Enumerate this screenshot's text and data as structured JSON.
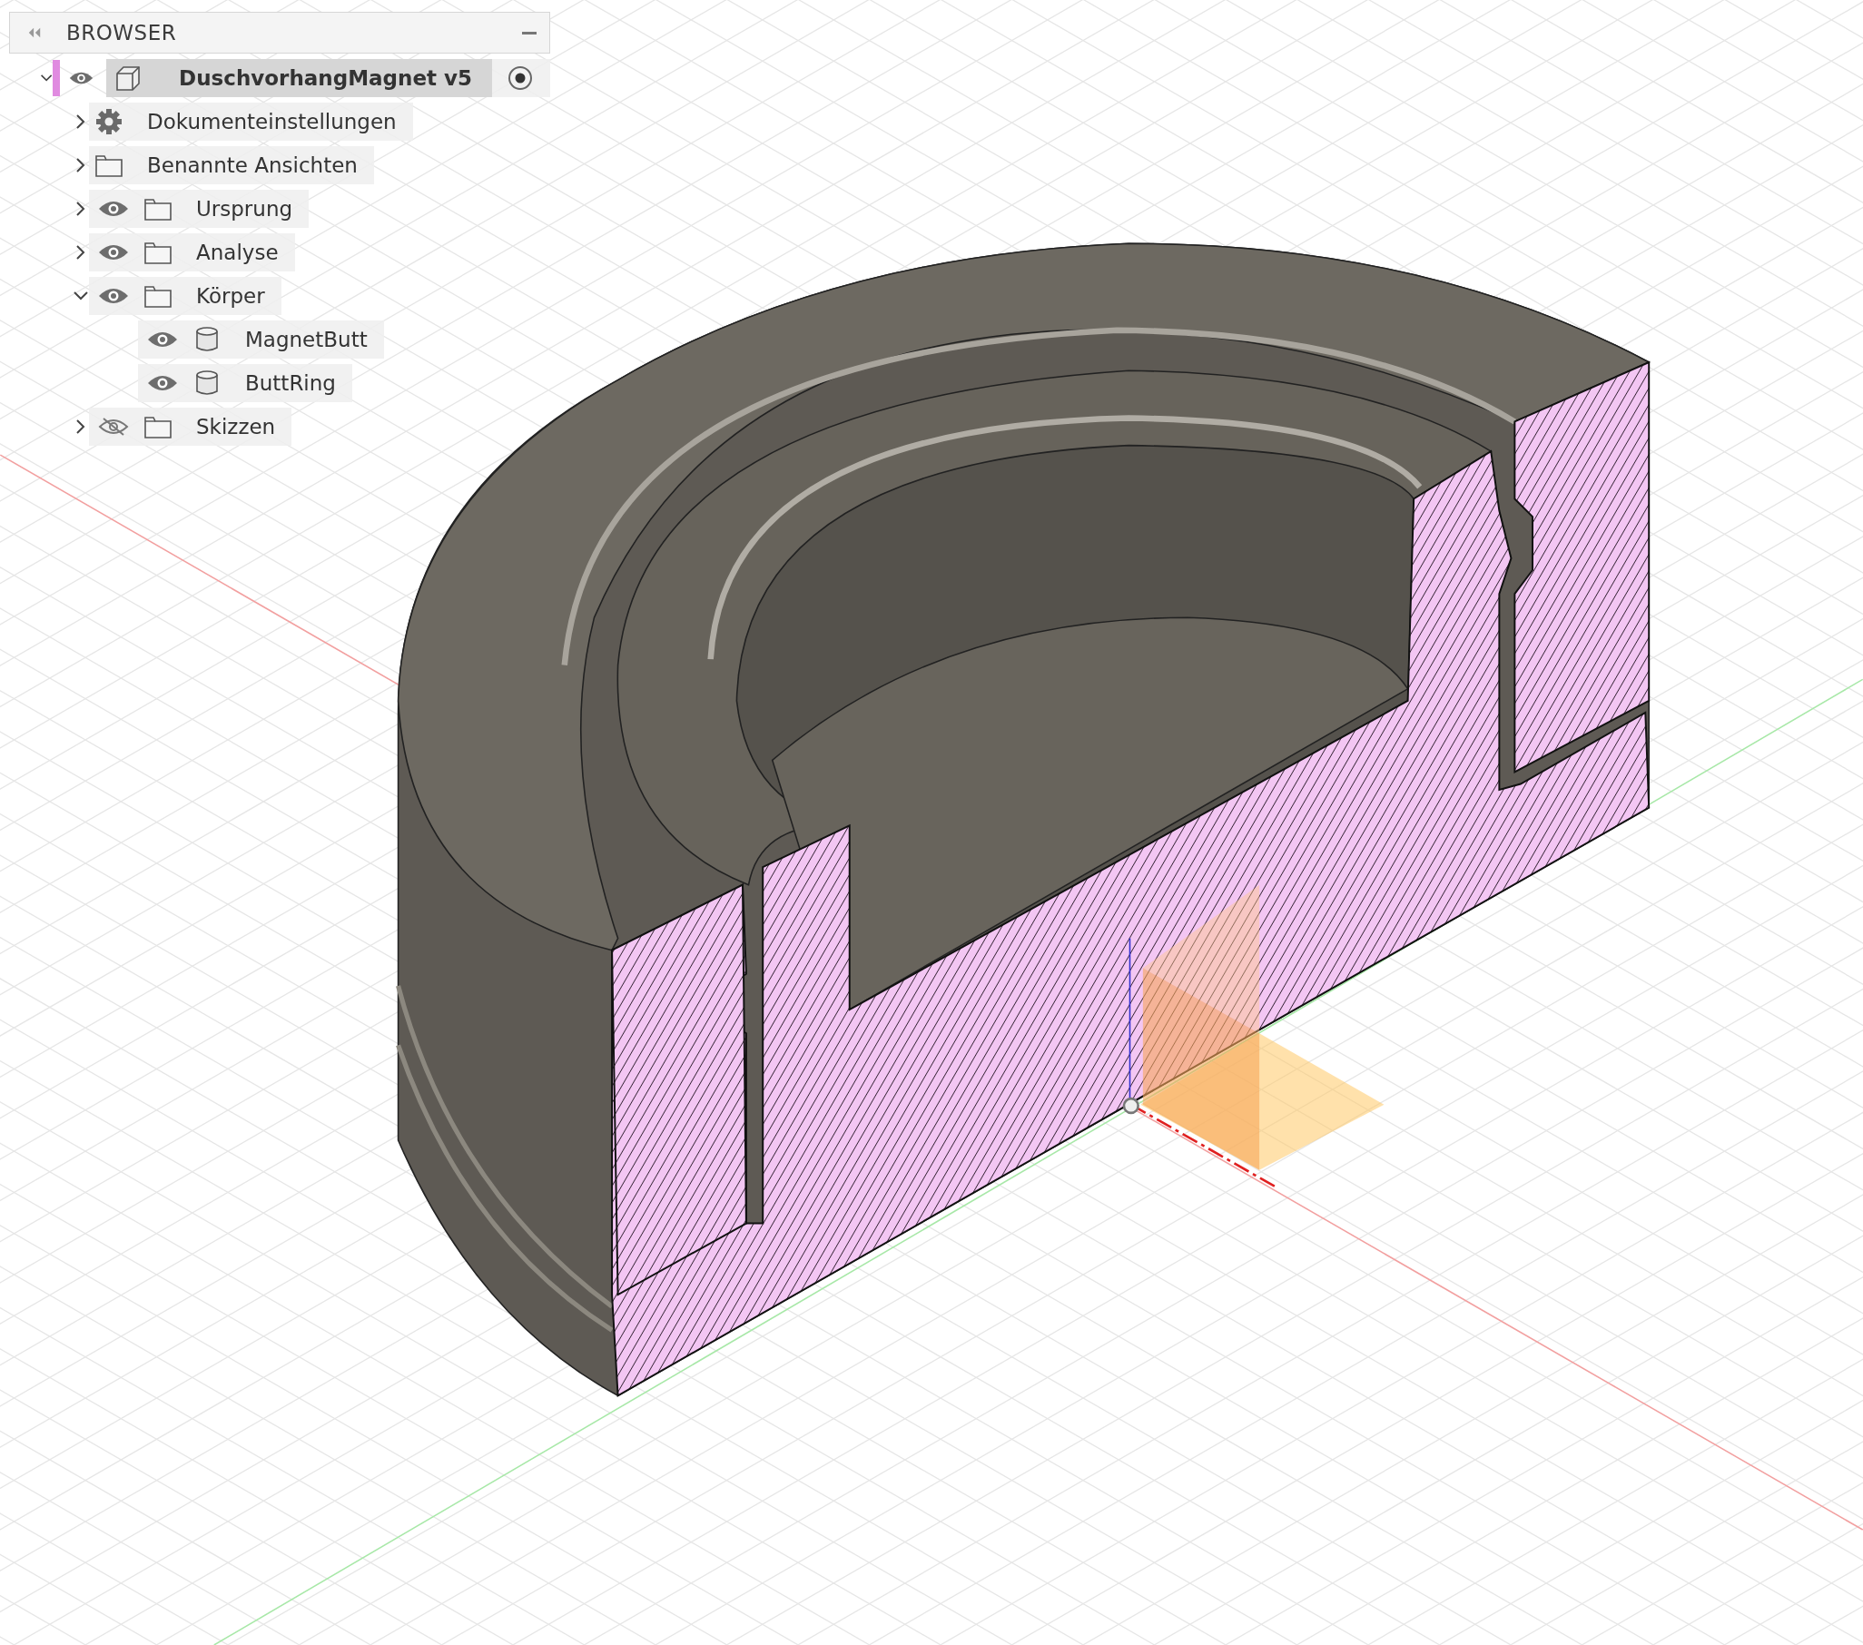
{
  "browser": {
    "title": "BROWSER",
    "tree": [
      {
        "label": "DuschvorhangMagnet v5",
        "kind": "component",
        "visible": true,
        "selected": true,
        "expanded": true,
        "active": true,
        "children": [
          {
            "label": "Dokumenteinstellungen",
            "kind": "settings",
            "selected": false,
            "expanded": false
          },
          {
            "label": "Benannte Ansichten",
            "kind": "folder",
            "selected": false,
            "expanded": false
          },
          {
            "label": "Ursprung",
            "kind": "folder",
            "visible": true,
            "selected": false,
            "expanded": false
          },
          {
            "label": "Analyse",
            "kind": "folder",
            "visible": true,
            "selected": false,
            "expanded": false
          },
          {
            "label": "Körper",
            "kind": "folder",
            "visible": true,
            "selected": false,
            "expanded": true,
            "children": [
              {
                "label": "MagnetButt",
                "kind": "body",
                "visible": true,
                "selected": false
              },
              {
                "label": "ButtRing",
                "kind": "body",
                "visible": true,
                "selected": false
              }
            ]
          },
          {
            "label": "Skizzen",
            "kind": "folder",
            "visible": false,
            "selected": false,
            "expanded": false
          }
        ]
      }
    ]
  }
}
